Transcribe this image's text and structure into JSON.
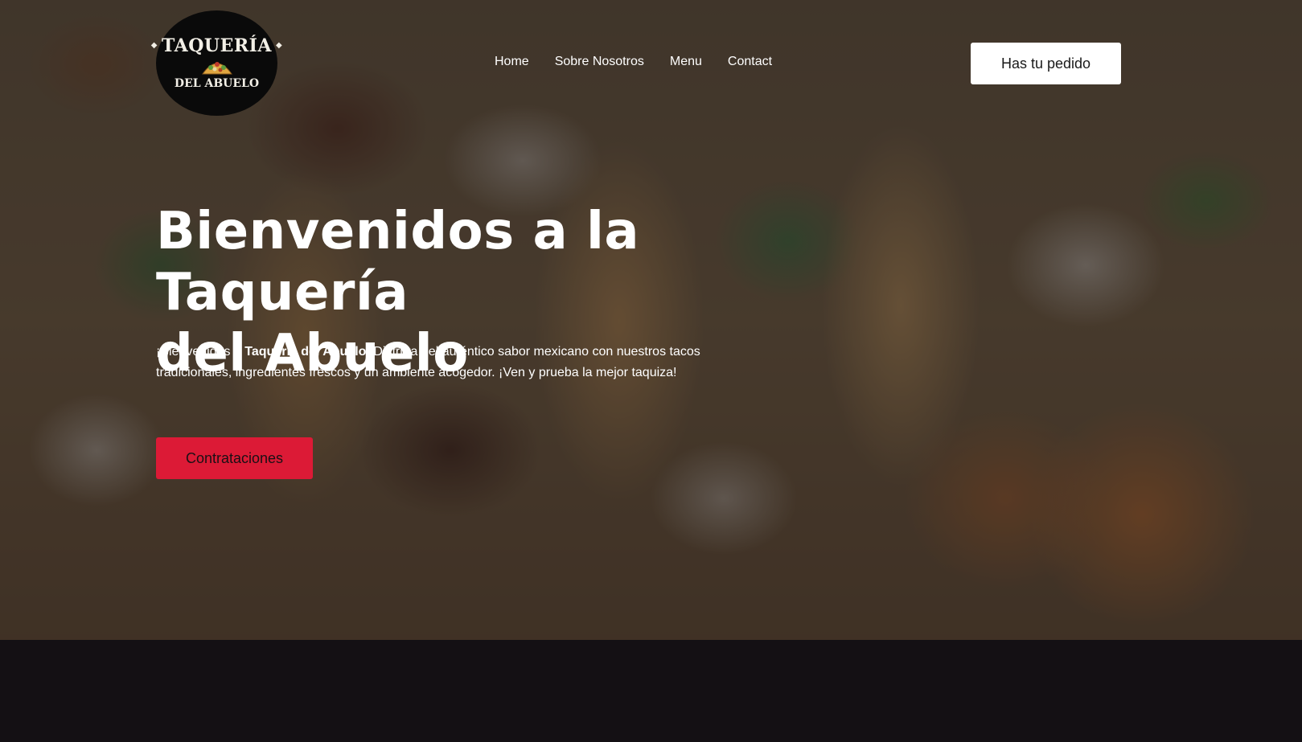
{
  "header": {
    "logo": {
      "top_text": "TAQUERÍA",
      "bottom_text": "DEL ABUELO",
      "icon": "taco-icon"
    },
    "nav": [
      {
        "label": "Home"
      },
      {
        "label": "Sobre Nosotros"
      },
      {
        "label": "Menu"
      },
      {
        "label": "Contact"
      }
    ],
    "order_button": "Has tu pedido"
  },
  "hero": {
    "title_line1": "Bienvenidos a la Taquería",
    "title_line2": "del Abuelo",
    "desc_pre": "¡Bienvenidos a ",
    "desc_bold": "Taquería del Abuelo",
    "desc_post": "!  Disfruta del auténtico sabor mexicano con nuestros tacos tradicionales, ingredientes frescos y un ambiente acogedor. ¡Ven y prueba la mejor taquiza!",
    "cta_button": "Contrataciones"
  },
  "colors": {
    "cta": "#dc1a36",
    "order_button_bg": "#ffffff",
    "page_bg": "#141014",
    "text": "#ffffff"
  }
}
